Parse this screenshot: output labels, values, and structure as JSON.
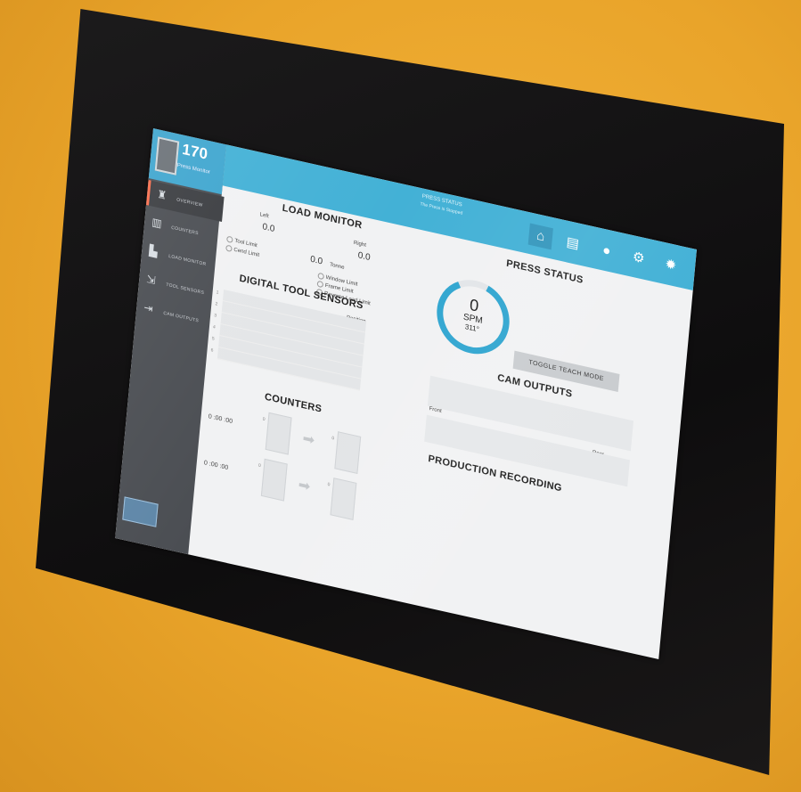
{
  "app": {
    "logo_number": "170",
    "logo_subtitle": "Press Monitor",
    "header_title": "PRESS STATUS",
    "header_subtitle": "The Press is Stopped"
  },
  "sidebar": {
    "items": [
      {
        "label": "OVERVIEW",
        "icon": "binoculars-icon"
      },
      {
        "label": "COUNTERS",
        "icon": "counter-icon"
      },
      {
        "label": "LOAD MONITOR",
        "icon": "bar-chart-icon"
      },
      {
        "label": "TOOL SENSORS",
        "icon": "sensor-icon"
      },
      {
        "label": "CAM OUTPUTS",
        "icon": "output-icon"
      }
    ]
  },
  "topbar": {
    "icons": [
      "home-icon",
      "message-icon",
      "stop-icon",
      "gear-icon",
      "alert-icon"
    ]
  },
  "load_monitor": {
    "title": "LOAD MONITOR",
    "left_label": "Left",
    "left_value": "0.0",
    "right_label": "Right",
    "right_value": "0.0",
    "total_value": "0.0",
    "total_label": "Tonne",
    "tool_limit": "Tool Limit",
    "cend_limit": "Cend Limit",
    "window_limit": "Window Limit",
    "frame_limit": "Frame Limit",
    "reverse_load_limit": "Reverse Load Limit"
  },
  "digital_tool_sensors": {
    "title": "DIGITAL TOOL SENSORS",
    "position_label": "Position",
    "rows": [
      "1",
      "2",
      "3",
      "4",
      "5",
      "6"
    ]
  },
  "counters": {
    "title": "COUNTERS",
    "rows": [
      {
        "time": "0 :00 :00",
        "from_label": "0",
        "to_label": "0"
      },
      {
        "time": "0 :00 :00",
        "from_label": "0",
        "to_label": "0"
      }
    ]
  },
  "press_status": {
    "title": "PRESS STATUS",
    "spm_value": "0",
    "spm_unit": "SPM",
    "angle": "311°",
    "toggle_button": "TOGGLE TEACH MODE"
  },
  "cam_outputs": {
    "title": "CAM OUTPUTS",
    "front_label": "Front",
    "rear_label": "Rear"
  },
  "production_recording": {
    "title": "PRODUCTION RECORDING"
  },
  "colors": {
    "accent": "#43b1d6",
    "sidebar": "#4b4e53",
    "active_marker": "#ff6f4e",
    "casing": "#e9a42a"
  }
}
